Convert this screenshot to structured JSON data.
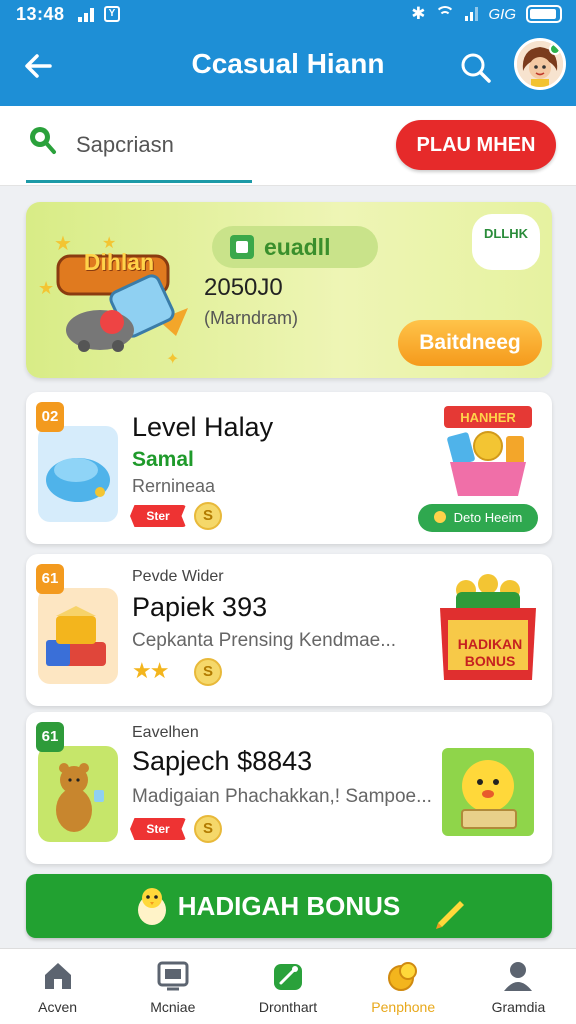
{
  "status": {
    "time": "13:48",
    "carrier": "GIG"
  },
  "header": {
    "title": "Ccasual Hiann"
  },
  "search": {
    "text": "Sapcriasn",
    "play_label": "PLAU MHEN"
  },
  "promo": {
    "badge": "euadll",
    "amount": "2050J0",
    "sub": "(Marndram)",
    "tag": "DLLHK",
    "art_label": "Dihlan",
    "button": "Baitdneeg"
  },
  "games": [
    {
      "rank": "02",
      "small": "",
      "title": "Level Halay",
      "sub": "Samal",
      "desc": "Rernineaa",
      "tag": "Ster",
      "coin": "S",
      "action": "Deto Heeim",
      "art_text": "HANHER"
    },
    {
      "rank": "61",
      "small": "Pevde Wider",
      "title": "Papiek 393",
      "desc": "Cepkanta Prensing Kendmae...",
      "coin": "S",
      "art_text": "HADIKAN BONUS"
    },
    {
      "rank": "61",
      "small": "Eavelhen",
      "title": "Sapjech $8843",
      "desc": "Madigaian Phachakkan,! Sampoe...",
      "tag": "Ster",
      "coin": "S"
    }
  ],
  "bonus": {
    "label": "HADIGAH BONUS"
  },
  "nav": [
    {
      "label": "Acven",
      "icon": "home-icon"
    },
    {
      "label": "Mcniae",
      "icon": "tv-icon"
    },
    {
      "label": "Dronthart",
      "icon": "gamepad-icon"
    },
    {
      "label": "Penphone",
      "icon": "coins-icon"
    },
    {
      "label": "Gramdia",
      "icon": "profile-icon"
    }
  ],
  "colors": {
    "primary": "#1e8fd6",
    "accent_red": "#e62a2a",
    "green": "#22a131",
    "orange": "#f59a1c",
    "active_nav": "#e8a81b"
  }
}
